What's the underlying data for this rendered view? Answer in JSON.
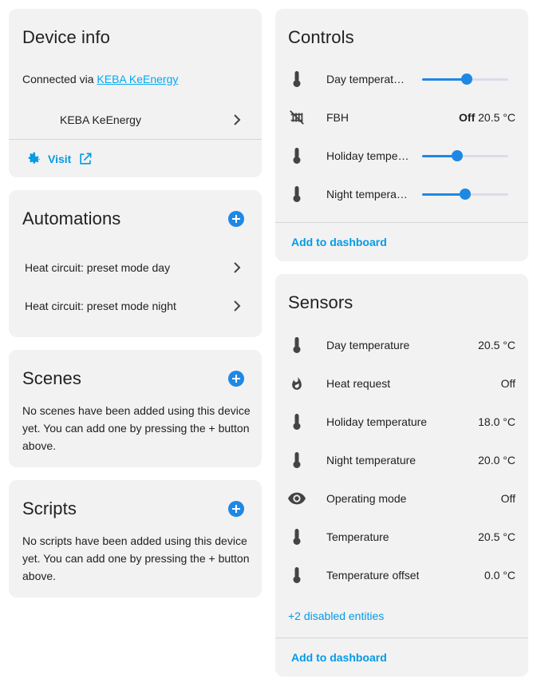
{
  "device_info": {
    "title": "Device info",
    "connected_prefix": "Connected via ",
    "connected_link": "KEBA KeEnergy",
    "integration_name": "KEBA KeEnergy",
    "visit_label": "Visit"
  },
  "automations": {
    "title": "Automations",
    "items": [
      {
        "label": "Heat circuit: preset mode day"
      },
      {
        "label": "Heat circuit: preset mode night"
      }
    ]
  },
  "scenes": {
    "title": "Scenes",
    "empty_text": "No scenes have been added using this device yet. You can add one by pressing the + button above."
  },
  "scripts": {
    "title": "Scripts",
    "empty_text": "No scripts have been added using this device yet. You can add one by pressing the + button above."
  },
  "controls": {
    "title": "Controls",
    "items": [
      {
        "name": "Day temperat…",
        "icon": "thermometer-icon",
        "type": "slider",
        "value": 0.52
      },
      {
        "name": "FBH",
        "icon": "radiator-off-icon",
        "type": "status",
        "state": "Off",
        "temp": "20.5 °C"
      },
      {
        "name": "Holiday tempe…",
        "icon": "thermometer-icon",
        "type": "slider",
        "value": 0.41
      },
      {
        "name": "Night tempera…",
        "icon": "thermometer-icon",
        "type": "slider",
        "value": 0.5
      }
    ],
    "add_to_dashboard": "Add to dashboard"
  },
  "sensors": {
    "title": "Sensors",
    "items": [
      {
        "name": "Day temperature",
        "icon": "thermometer-icon",
        "value": "20.5 °C"
      },
      {
        "name": "Heat request",
        "icon": "fire-icon",
        "value": "Off"
      },
      {
        "name": "Holiday temperature",
        "icon": "thermometer-icon",
        "value": "18.0 °C"
      },
      {
        "name": "Night temperature",
        "icon": "thermometer-icon",
        "value": "20.0 °C"
      },
      {
        "name": "Operating mode",
        "icon": "eye-icon",
        "value": "Off"
      },
      {
        "name": "Temperature",
        "icon": "thermometer-icon",
        "value": "20.5 °C"
      },
      {
        "name": "Temperature offset",
        "icon": "thermometer-icon",
        "value": "0.0 °C"
      }
    ],
    "disabled_entities": "+2 disabled entities",
    "add_to_dashboard": "Add to dashboard"
  },
  "colors": {
    "accent": "#1e88e5",
    "link": "#03a9f4",
    "card_bg": "#f2f2f2"
  }
}
